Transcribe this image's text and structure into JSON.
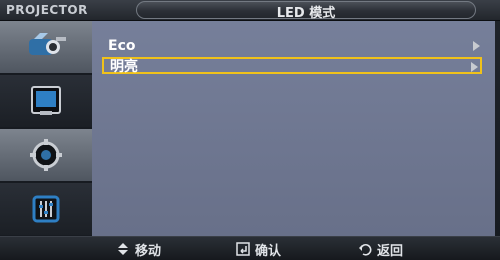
{
  "header": {
    "brand": "PROJECTOR",
    "title": "LED 模式"
  },
  "sidebar": {
    "items": [
      {
        "icon": "input-icon",
        "active": true
      },
      {
        "icon": "picture-icon",
        "active": false
      },
      {
        "icon": "settings-icon",
        "active": false
      },
      {
        "icon": "equalizer-icon",
        "active": false
      }
    ]
  },
  "menu": {
    "items": [
      {
        "label": "Eco",
        "has_submenu": true,
        "selected": false
      },
      {
        "label": "明亮",
        "has_submenu": true,
        "selected": true
      }
    ]
  },
  "footer": {
    "move_label": "移动",
    "confirm_label": "确认",
    "return_label": "返回"
  },
  "colors": {
    "selection": "#f0c21a",
    "content_bg": "#737c97"
  }
}
